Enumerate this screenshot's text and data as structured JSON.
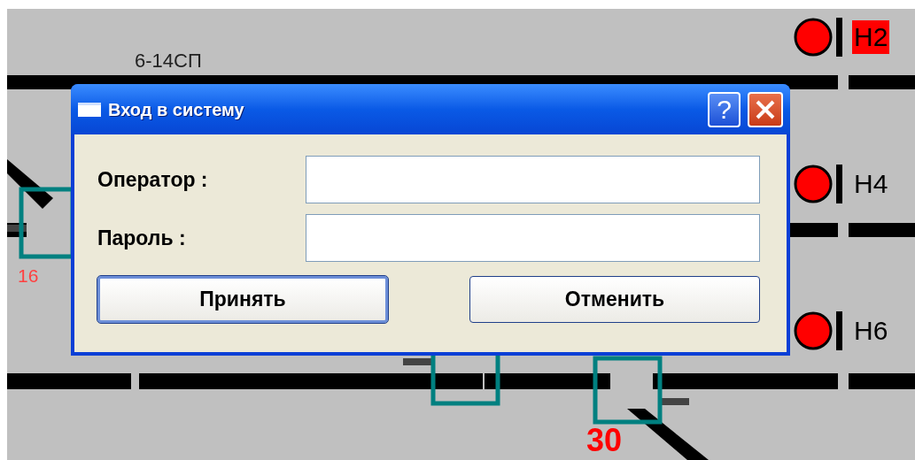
{
  "diagram": {
    "track_labels": [
      {
        "text": "6-14СП",
        "kind": "plain"
      },
      {
        "text": "16",
        "kind": "alert"
      },
      {
        "text": "30",
        "kind": "number"
      }
    ],
    "signals": [
      {
        "name": "Н2",
        "highlighted": true
      },
      {
        "name": "Н4",
        "highlighted": false
      },
      {
        "name": "Н6",
        "highlighted": false
      }
    ]
  },
  "dialog": {
    "title": "Вход в систему",
    "help_button": "?",
    "fields": [
      {
        "label": "Оператор :"
      },
      {
        "label": "Пароль :"
      }
    ],
    "buttons": [
      {
        "label": "Принять",
        "default": true
      },
      {
        "label": "Отменить",
        "default": false
      }
    ]
  }
}
